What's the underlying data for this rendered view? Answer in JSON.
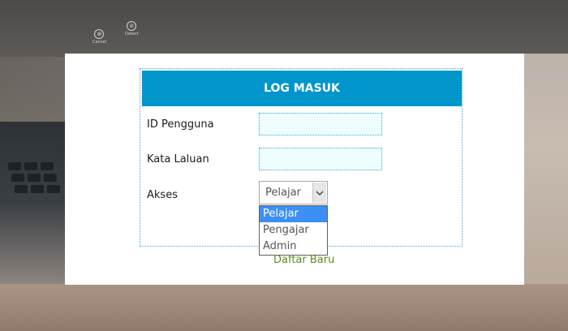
{
  "background": {
    "icons": [
      {
        "glyph": "⊗",
        "caption": "Cancel"
      },
      {
        "glyph": "⊘",
        "caption": "Detect"
      }
    ]
  },
  "login": {
    "title": "LOG MASUK",
    "header_color": "#0096cc",
    "fields": {
      "user_id_label": "ID Pengguna",
      "user_id_value": "",
      "password_label": "Kata Laluan",
      "password_value": "",
      "access_label": "Akses"
    },
    "access_select": {
      "selected": "Pelajar",
      "options": [
        "Pelajar",
        "Pengajar",
        "Admin"
      ],
      "highlighted": "Pelajar"
    },
    "register_link": "Daftar Baru",
    "link_color": "#5b8a22"
  }
}
